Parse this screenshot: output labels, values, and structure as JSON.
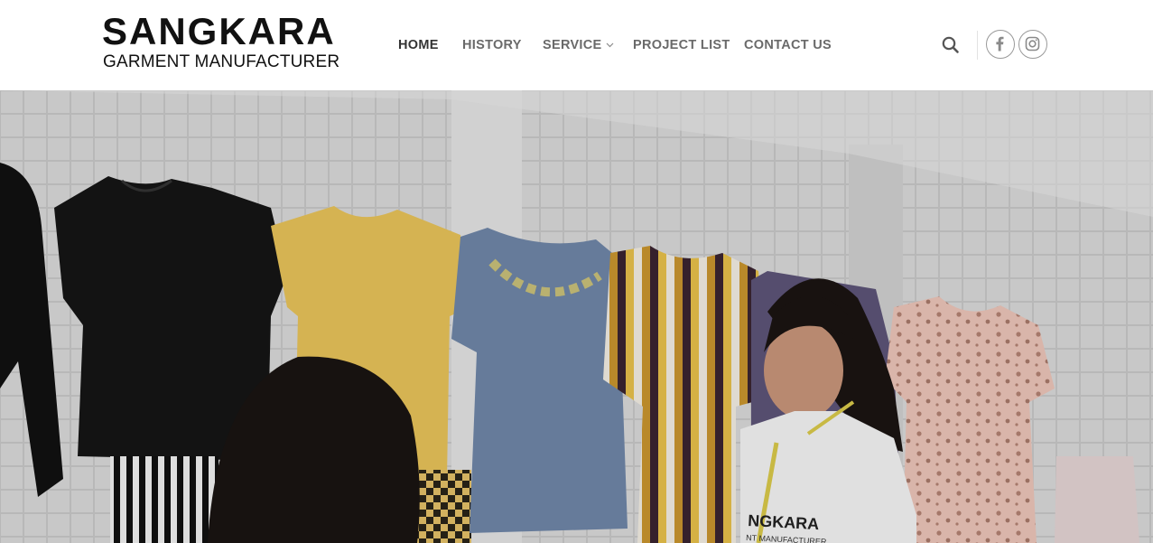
{
  "logo": {
    "title": "SANGKARA",
    "subtitle": "GARMENT MANUFACTURER"
  },
  "nav": {
    "items": [
      {
        "label": "HOME",
        "active": true
      },
      {
        "label": "HISTORY"
      },
      {
        "label": "SERVICE",
        "has_dropdown": true
      },
      {
        "label": "PROJECT LIST"
      },
      {
        "label": "CONTACT US"
      }
    ]
  },
  "header_icons": [
    "search-icon",
    "facebook-icon",
    "instagram-icon"
  ],
  "hero": {
    "image_description_icon": "hero-image",
    "shirt_print": [
      "NGKARA",
      "NT MANUFACTURER"
    ]
  },
  "colors": {
    "nav_text": "#6a6a6a",
    "nav_active": "#333333",
    "icon_gray": "#666666"
  }
}
